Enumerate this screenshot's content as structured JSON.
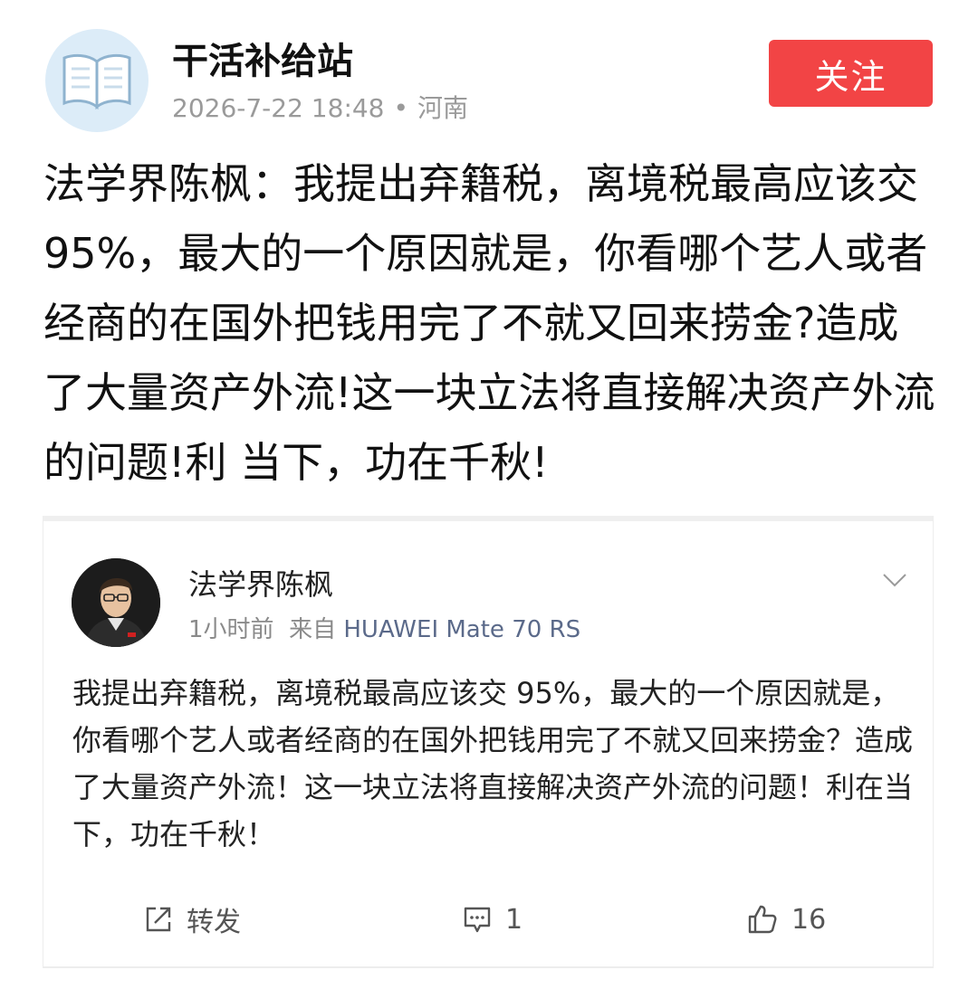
{
  "header": {
    "author_name": "干活补给站",
    "timestamp": "2026-7-22 18:48",
    "separator": "•",
    "location": "河南",
    "follow_label": "关注",
    "avatar_icon": "book-icon"
  },
  "post": {
    "text": "法学界陈枫：我提出弃籍税，离境税最高应该交95%，最大的一个原因就是，你看哪个艺人或者经商的在国外把钱用完了不就又回来捞金?造成了大量资产外流!这一块立法将直接解决资产外流的问题!利 当下，功在千秋!"
  },
  "embedded": {
    "author_name": "法学界陈枫",
    "time_ago": "1小时前",
    "from_label": "来自",
    "device": "HUAWEI Mate 70 RS",
    "text": "我提出弃籍税，离境税最高应该交 95%，最大的一个原因就是，你看哪个艺人或者经商的在国外把钱用完了不就又回来捞金？造成了大量资产外流！这一块立法将直接解决资产外流的问题！利在当下，功在千秋！",
    "actions": {
      "repost_label": "转发",
      "comment_count": "1",
      "like_count": "16"
    },
    "icons": [
      "chevron-down-icon",
      "repost-icon",
      "comment-icon",
      "like-icon"
    ]
  },
  "colors": {
    "follow_button": "#f24445",
    "meta_gray": "#9a9a9a",
    "device_link": "#5b6a8a"
  }
}
